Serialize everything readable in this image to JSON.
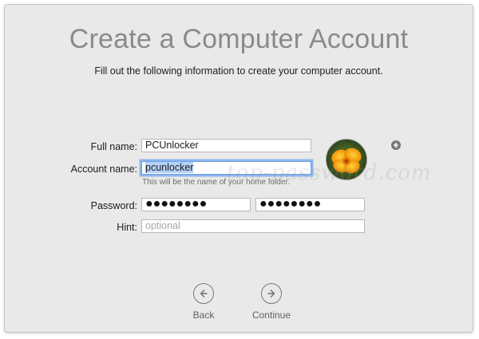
{
  "window": {
    "title": "Create a Computer Account",
    "subtitle": "Fill out the following information to create your computer account."
  },
  "form": {
    "full_name_label": "Full name:",
    "full_name_value": "PCUnlocker",
    "account_name_label": "Account name:",
    "account_name_value": "pcunlocker",
    "account_name_help": "This will be the name of your home folder.",
    "password_label": "Password:",
    "password_value": "●●●●●●●●",
    "verify_value": "●●●●●●●●",
    "hint_label": "Hint:",
    "hint_placeholder": "optional"
  },
  "avatar": {
    "icon": "flower-photo",
    "edit_icon": "arrow-left-icon"
  },
  "watermark": "top-password.com",
  "navigation": {
    "back_label": "Back",
    "back_icon": "arrow-left-circle-icon",
    "continue_label": "Continue",
    "continue_icon": "arrow-right-circle-icon"
  },
  "colors": {
    "window_bg": "#e9e9e9",
    "title": "#8a8a8a",
    "focus_ring": "#8db6ec",
    "selection": "#b3d2f7"
  }
}
